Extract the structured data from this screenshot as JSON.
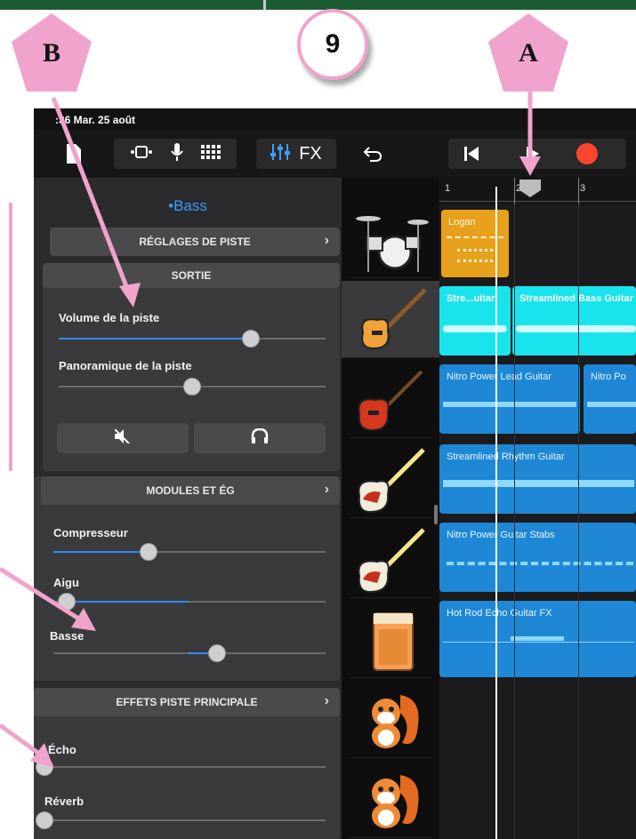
{
  "annotations": {
    "step_number": "9",
    "label_a": "A",
    "label_b": "B"
  },
  "status_bar": {
    "time_date": ":36  Mar. 25 août"
  },
  "toolbar": {
    "fx_label": "FX"
  },
  "panel": {
    "track_name": "•Bass",
    "track_settings_label": "RÉGLAGES DE PISTE",
    "output_label": "SORTIE",
    "volume_label": "Volume de la piste",
    "volume_value": 0.72,
    "pan_label": "Panoramique de la piste",
    "pan_value": 0.5,
    "modules_label": "MODULES ET ÉG",
    "compressor_label": "Compresseur",
    "compressor_value": 0.35,
    "treble_label": "Aigu",
    "treble_value": 0.05,
    "bass_label": "Basse",
    "bass_value": 0.6,
    "master_effects_label": "EFFETS PISTE PRINCIPALE",
    "echo_label": "Écho",
    "echo_value": 0.0,
    "reverb_label": "Réverb",
    "reverb_value": 0.0
  },
  "timeline": {
    "ruler_marks": [
      "1",
      "2",
      "3"
    ],
    "clips": {
      "drums": "Logan",
      "bass_a": "Stre...uitar",
      "bass_b": "Streamlined Bass Guitar",
      "lead_a": "Nitro Power Lead Guitar",
      "lead_b": "Nitro Po",
      "rhythm": "Streamlined Rhythm Guitar",
      "stabs": "Nitro Power Guitar Stabs",
      "fx": "Hot Rod Echo Guitar FX"
    }
  },
  "colors": {
    "annotation_pink": "#f0a3cc",
    "accent_blue": "#2f8cff",
    "drummer_orange": "#e8a11c",
    "bass_cyan": "#19e4ee",
    "guitar_blue": "#1e88d6",
    "record_red": "#ff4530"
  }
}
